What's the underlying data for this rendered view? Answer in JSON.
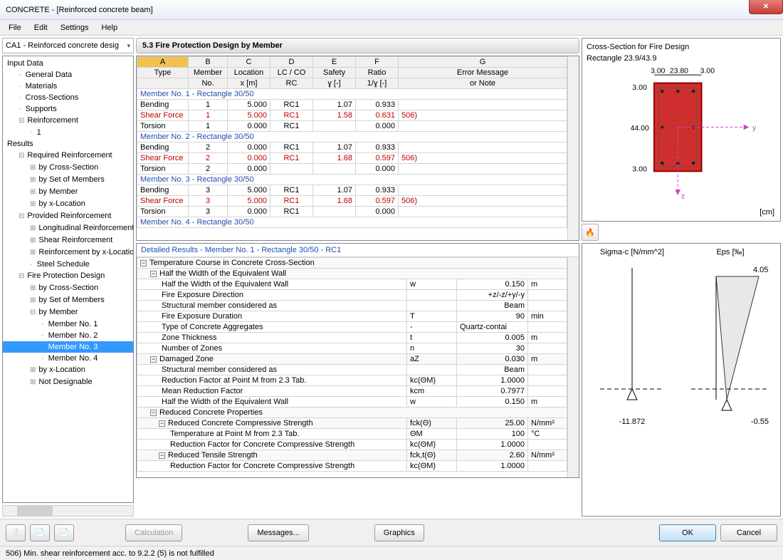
{
  "window": {
    "title": "CONCRETE - [Reinforced concrete beam]"
  },
  "menu": {
    "file": "File",
    "edit": "Edit",
    "settings": "Settings",
    "help": "Help"
  },
  "combo": {
    "value": "CA1 - Reinforced concrete desig"
  },
  "tree": {
    "input_data": "Input Data",
    "general_data": "General Data",
    "materials": "Materials",
    "cross_sections": "Cross-Sections",
    "supports": "Supports",
    "reinforcement": "Reinforcement",
    "one": "1",
    "results": "Results",
    "required": "Required Reinforcement",
    "by_cs": "by Cross-Section",
    "by_set": "by Set of Members",
    "by_member": "by Member",
    "by_x": "by x-Location",
    "provided": "Provided Reinforcement",
    "long": "Longitudinal Reinforcement",
    "shear": "Shear Reinforcement",
    "rbyx": "Reinforcement by x-Location",
    "steel": "Steel Schedule",
    "fire": "Fire Protection Design",
    "m1": "Member No. 1",
    "m2": "Member No. 2",
    "m3": "Member No. 3",
    "m4": "Member No. 4",
    "not": "Not Designable"
  },
  "section_title": "5.3 Fire Protection Design by Member",
  "cols": {
    "A": "A",
    "B": "B",
    "C": "C",
    "D": "D",
    "E": "E",
    "F": "F",
    "G": "G",
    "type": "Type",
    "member_no": "Member",
    "member_no2": "No.",
    "loc": "Location",
    "loc2": "x [m]",
    "lc": "LC / CO",
    "lc2": "RC",
    "safety": "Safety",
    "safety2": "ɣ [-]",
    "ratio": "Ratio",
    "ratio2": "1/ɣ [-]",
    "err": "Error Message",
    "err2": "or Note"
  },
  "groups": {
    "g1": "Member No. 1 - Rectangle 30/50",
    "g2": "Member No. 2 - Rectangle 30/50",
    "g3": "Member No. 3 - Rectangle 30/50",
    "g4": "Member No. 4 - Rectangle 30/50"
  },
  "rows": {
    "bend": "Bending",
    "shear": "Shear Force",
    "tors": "Torsion",
    "r1": [
      "1",
      "5.000",
      "RC1",
      "1.07",
      "0.933",
      ""
    ],
    "r2": [
      "1",
      "5.000",
      "RC1",
      "1.58",
      "0.631",
      "506)"
    ],
    "r3": [
      "1",
      "0.000",
      "RC1",
      "",
      "0.000",
      ""
    ],
    "r4": [
      "2",
      "0.000",
      "RC1",
      "1.07",
      "0.933",
      ""
    ],
    "r5": [
      "2",
      "0.000",
      "RC1",
      "1.68",
      "0.597",
      "506)"
    ],
    "r6": [
      "2",
      "0.000",
      "",
      "",
      "0.000",
      ""
    ],
    "r7": [
      "3",
      "5.000",
      "RC1",
      "1.07",
      "0.933",
      ""
    ],
    "r8": [
      "3",
      "5.000",
      "RC1",
      "1.68",
      "0.597",
      "506)"
    ],
    "r9": [
      "3",
      "0.000",
      "RC1",
      "",
      "0.000",
      ""
    ]
  },
  "detail_header": "Detailed Results  -  Member No. 1  -  Rectangle 30/50  -  RC1",
  "detail": {
    "temp": "Temperature Course in Concrete Cross-Section",
    "half": "Half the Width of the Equivalent Wall",
    "w": "w",
    "w_v": "0.150",
    "m": "m",
    "fed": "Fire Exposure Direction",
    "fed_v": "+z/-z/+y/-y",
    "smc": "Structural member considered as",
    "beam": "Beam",
    "dur": "Fire Exposure Duration",
    "T": "T",
    "dur_v": "90",
    "min": "min",
    "agg": "Type of Concrete Aggregates",
    "dash": "-",
    "agg_v": "Quartz-contai",
    "zt": "Zone Thickness",
    "t": "t",
    "zt_v": "0.005",
    "nz": "Number of Zones",
    "n": "n",
    "nz_v": "30",
    "dz": "Damaged Zone",
    "az": "aZ",
    "az_v": "0.030",
    "rf": "Reduction Factor at Point M from 2.3 Tab.",
    "kc": "kc(ΘM)",
    "rf_v": "1.0000",
    "mrf": "Mean Reduction Factor",
    "kcm": "kcm",
    "mrf_v": "0.7977",
    "rcp": "Reduced Concrete Properties",
    "rccs": "Reduced Concrete Compressive Strength",
    "fck": "fck(Θ)",
    "fck_v": "25.00",
    "nmm": "N/mm²",
    "tpm": "Temperature at Point M from 2.3 Tab.",
    "thm": "ΘM",
    "thm_v": "100",
    "degc": "°C",
    "rfccs": "Reduction Factor for Concrete Compressive Strength",
    "kc2": "kc(ΘM)",
    "kc2_v": "1.0000",
    "rts": "Reduced Tensile Strength",
    "fckt": "fck,t(Θ)",
    "rts_v": "2.60"
  },
  "cs": {
    "title": "Cross-Section for Fire Design",
    "sub": "Rectangle 23.9/43.9",
    "d1": "3.00",
    "d2": "23.80",
    "d3": "3.00",
    "h1": "3.00",
    "h2": "44.00",
    "h3": "3.00",
    "y": "y",
    "z": "z",
    "unit": "[cm]"
  },
  "chart": {
    "sigma": "Sigma-c [N/mm^2]",
    "eps": "Eps [‰]",
    "v1": "-11.872",
    "v2": "4.05",
    "v3": "-0.55"
  },
  "chart_data": {
    "type": "line",
    "series": [
      {
        "name": "Sigma-c",
        "unit": "N/mm^2",
        "top": 0,
        "bottom": -11.872
      },
      {
        "name": "Eps",
        "unit": "‰",
        "top": 4.05,
        "bottom": -0.55
      }
    ]
  },
  "footer": {
    "calc": "Calculation",
    "msg": "Messages...",
    "gfx": "Graphics",
    "ok": "OK",
    "cancel": "Cancel",
    "help_icon": "?",
    "open_icon": "📂",
    "save_icon": "💾"
  },
  "status": "506) Min. shear reinforcement acc. to 9.2.2 (5)  is not fulfilled"
}
